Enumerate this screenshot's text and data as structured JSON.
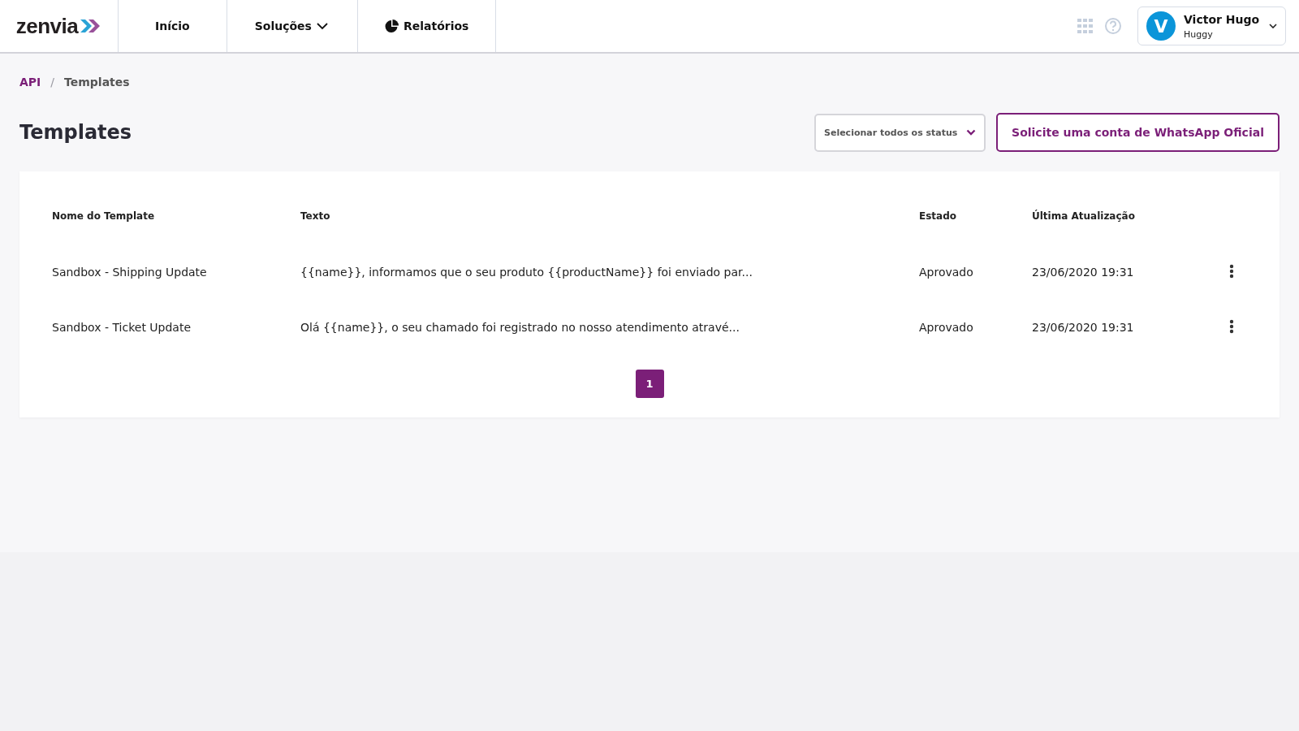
{
  "header": {
    "logo": "zenvia",
    "nav": [
      {
        "label": "Início",
        "kind": "plain"
      },
      {
        "label": "Soluções",
        "kind": "dropdown"
      },
      {
        "label": "Relatórios",
        "kind": "chart"
      }
    ],
    "user": {
      "initial": "V",
      "name": "Victor Hugo",
      "org": "Huggy"
    }
  },
  "breadcrumb": [
    "API",
    "Templates"
  ],
  "breadcrumb_separator": "/",
  "page_title": "Templates",
  "status_filter": "Selecionar todos os status",
  "request_button": "Solicite uma conta de WhatsApp Oficial",
  "table": {
    "columns": [
      "Nome do Template",
      "Texto",
      "Estado",
      "Última Atualização"
    ],
    "rows": [
      {
        "name": "Sandbox - Shipping Update",
        "text": "{{name}}, informamos que o seu produto {{productName}} foi enviado par...",
        "status": "Aprovado",
        "updated": "23/06/2020 19:31"
      },
      {
        "name": "Sandbox - Ticket Update",
        "text": "Olá {{name}}, o seu chamado foi registrado no nosso atendimento atravé...",
        "status": "Aprovado",
        "updated": "23/06/2020 19:31"
      }
    ]
  },
  "pagination": [
    {
      "label": "1",
      "selected": true
    }
  ]
}
